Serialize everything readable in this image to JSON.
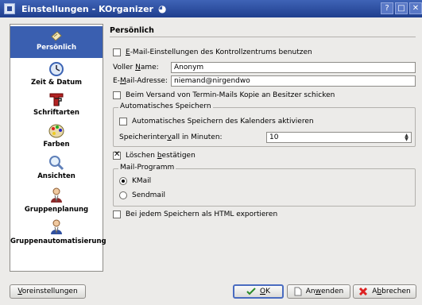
{
  "window": {
    "title": "Einstellungen - KOrganizer",
    "title_glyph": "◕",
    "buttons": [
      "?",
      "□",
      "✕"
    ]
  },
  "sidebar": {
    "items": [
      {
        "label": "Persönlich",
        "active": true
      },
      {
        "label": "Zeit & Datum",
        "active": false
      },
      {
        "label": "Schriftarten",
        "active": false
      },
      {
        "label": "Farben",
        "active": false
      },
      {
        "label": "Ansichten",
        "active": false
      },
      {
        "label": "Gruppenplanung",
        "active": false
      },
      {
        "label": "Gruppenautomatisierung",
        "active": false
      }
    ]
  },
  "main": {
    "title": "Persönlich",
    "use_kcontrol_email": {
      "label_pre": "",
      "label_key": "E",
      "label_post": "-Mail-Einstellungen des Kontrollzentrums benutzen",
      "checked": false
    },
    "full_name": {
      "label_pre": "Voller ",
      "label_key": "N",
      "label_post": "ame:",
      "value": "Anonym"
    },
    "email": {
      "label_pre": "E-",
      "label_key": "M",
      "label_post": "ail-Adresse:",
      "value": "niemand@nirgendwo"
    },
    "copy_to_owner": {
      "label": "Beim Versand von Termin-Mails Kopie an Besitzer schicken",
      "checked": false
    },
    "autosave": {
      "title": "Automatisches Speichern",
      "enable": {
        "label": "Automatisches Speichern des Kalenders aktivieren",
        "checked": false
      },
      "interval": {
        "label_pre": "Speicherinter",
        "label_key": "v",
        "label_post": "all in Minuten:",
        "value": "10"
      }
    },
    "confirm_delete": {
      "label_pre": "Löschen ",
      "label_key": "b",
      "label_post": "estätigen",
      "checked": true
    },
    "mail_client": {
      "title": "Mail-Programm",
      "options": [
        {
          "label": "KMail",
          "selected": true
        },
        {
          "label": "Sendmail",
          "selected": false
        }
      ]
    },
    "html_export": {
      "label": "Bei jedem Speichern als HTML exportieren",
      "checked": false
    }
  },
  "footer": {
    "defaults": {
      "label_pre": "",
      "label_key": "V",
      "label_post": "oreinstellungen"
    },
    "ok": {
      "label_pre": "",
      "label_key": "O",
      "label_post": "K"
    },
    "apply": {
      "label_pre": "An",
      "label_key": "w",
      "label_post": "enden"
    },
    "cancel": {
      "label_pre": "A",
      "label_key": "b",
      "label_post": "brechen"
    }
  },
  "colors": {
    "titlebar": "#2b4a9a",
    "selection": "#3a5fb0",
    "background": "#ecebe9"
  }
}
